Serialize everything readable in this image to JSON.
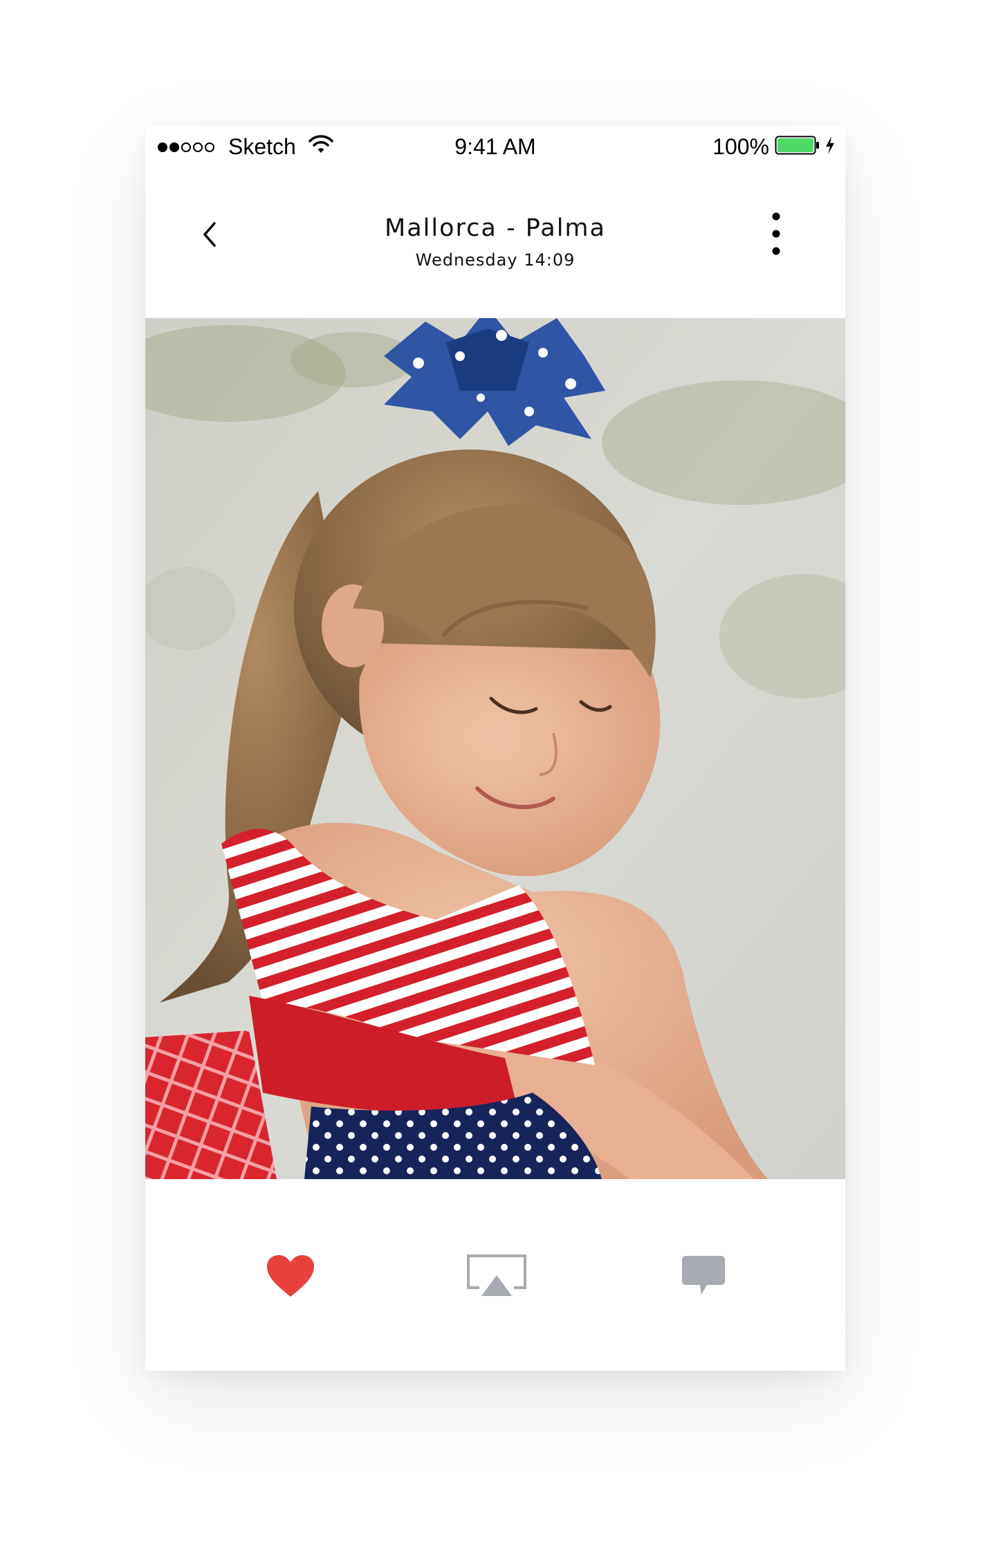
{
  "status_bar": {
    "carrier": "Sketch",
    "time": "9:41 AM",
    "battery": "100%",
    "signal_strength": "2 of 5",
    "battery_color": "#4cd964"
  },
  "header": {
    "title": "Mallorca - Palma",
    "subtitle": "Wednesday 14:09",
    "back_icon": "chevron-left-icon",
    "menu_icon": "more-vertical-icon"
  },
  "toolbar": {
    "like_icon": "heart-icon",
    "like_color": "#e8413b",
    "airplay_icon": "airplay-icon",
    "comment_icon": "comment-icon",
    "inactive_color": "#a7aab0"
  }
}
